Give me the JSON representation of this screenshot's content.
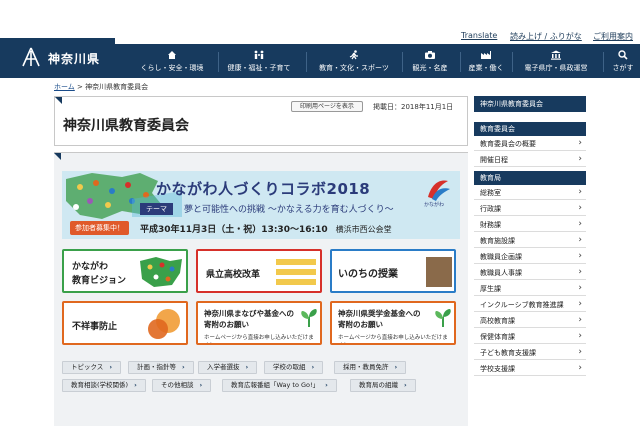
{
  "utility": {
    "translate": "Translate",
    "furigana": "読み上げ / ふりがな",
    "usage": "ご利用案内"
  },
  "site": {
    "name": "神奈川県"
  },
  "nav": [
    {
      "label": "くらし・安全・環境",
      "icon": "house-icon"
    },
    {
      "label": "健康・福祉・子育て",
      "icon": "family-icon"
    },
    {
      "label": "教育・文化・スポーツ",
      "icon": "runner-icon"
    },
    {
      "label": "観光・名産",
      "icon": "camera-icon"
    },
    {
      "label": "産業・働く",
      "icon": "factory-icon"
    },
    {
      "label": "電子県庁・県政運営",
      "icon": "building-icon"
    },
    {
      "label": "さがす",
      "icon": "search-icon"
    }
  ],
  "breadcrumb": {
    "home": "ホーム",
    "sep": ">",
    "current": "神奈川県教育委員会"
  },
  "page": {
    "title": "神奈川県教育委員会",
    "print_label": "印刷用ページを表示",
    "published": "掲載日：2018年11月1日"
  },
  "banner": {
    "title": "かながわ人づくりコラボ2018",
    "theme_label": "テーマ",
    "subtitle": "夢と可能性への挑戦 〜かなえる力を育む人づくり〜",
    "join": "参加者募集中！",
    "date": "平成30年11月3日（土・祝）13:30〜16:10",
    "venue": "横浜市西公会堂",
    "logo_text": "かながわ"
  },
  "tiles": [
    {
      "line1": "かながわ",
      "line2": "教育ビジョン"
    },
    {
      "line1": "県立高校改革",
      "line2": ""
    },
    {
      "line1": "いのちの授業",
      "line2": ""
    },
    {
      "line1": "不祥事防止",
      "line2": ""
    },
    {
      "line1": "神奈川県まなびや基金への",
      "line2": "寄附のお願い",
      "note": "ホームページから直接お申し込みいただけます！"
    },
    {
      "line1": "神奈川県奨学金基金への",
      "line2": "寄附のお願い",
      "note": "ホームページから直接お申し込みいただけます！"
    }
  ],
  "tags_row1": [
    "トピックス",
    "計画・指針等",
    "入学者選抜",
    "学校の取組",
    "採用・教員免許"
  ],
  "tags_row2": [
    "教育相談(学校関係)",
    "その他相談",
    "教育広報番組「Way to Go!」",
    "教育局の組織"
  ],
  "sidebar": {
    "top_link": "神奈川県教育委員会",
    "section1": "教育委員会",
    "section1_items": [
      "教育委員会の概要",
      "開催日程"
    ],
    "section2": "教育局",
    "section2_items": [
      "総務室",
      "行政課",
      "財務課",
      "教育施設課",
      "教職員企画課",
      "教職員人事課",
      "厚生課",
      "インクルーシブ教育推進課",
      "高校教育課",
      "保健体育課",
      "子ども教育支援課",
      "学校支援課"
    ]
  },
  "colors": {
    "navy": "#173a5e",
    "accent_orange": "#e0681f",
    "accent_red": "#d6302a",
    "accent_green": "#3aa04a",
    "accent_blue": "#2a7cc7"
  }
}
